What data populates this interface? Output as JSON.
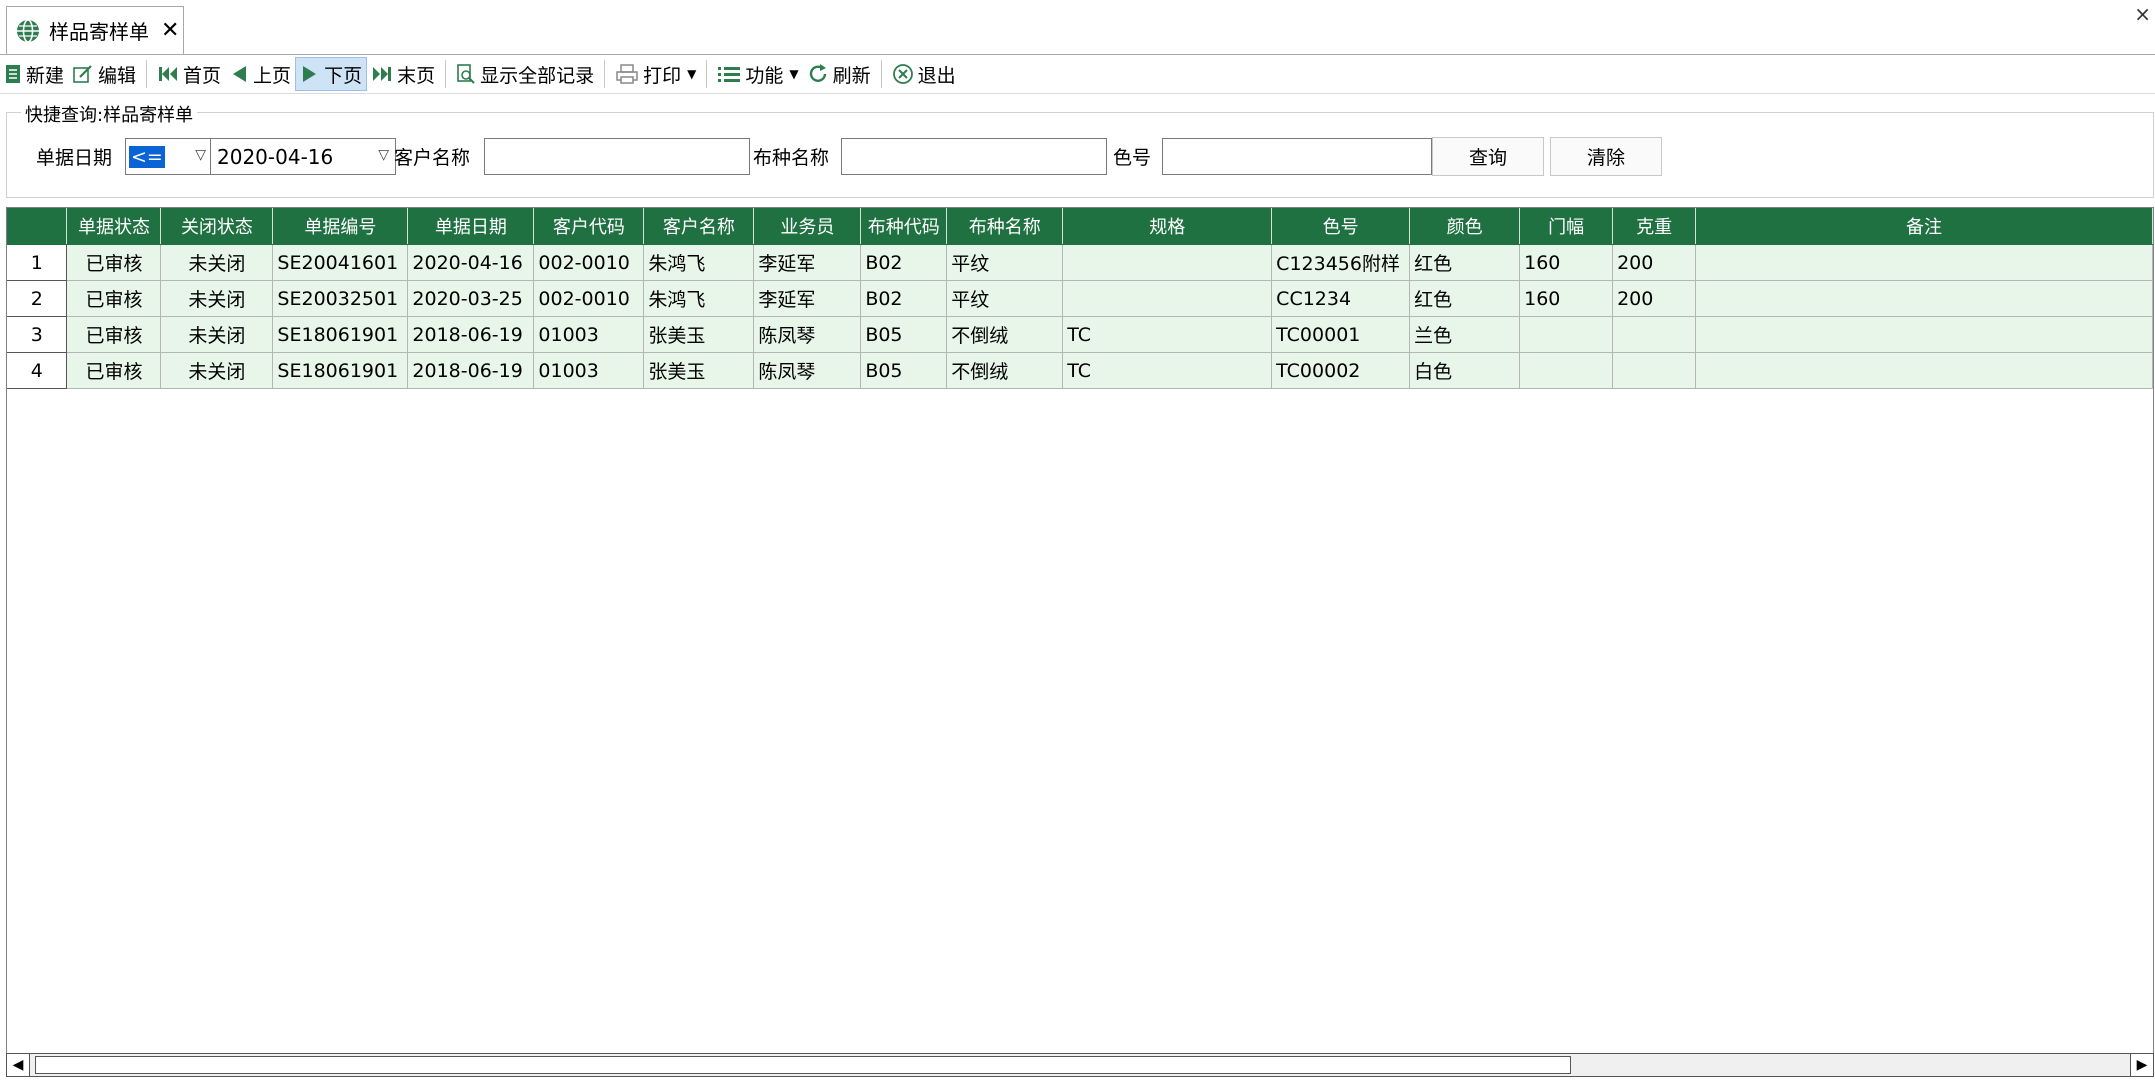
{
  "tab": {
    "label": "样品寄样单",
    "close": "✕"
  },
  "window_close": "×",
  "toolbar": {
    "new": "新建",
    "edit": "编辑",
    "first": "首页",
    "prev": "上页",
    "next": "下页",
    "last": "末页",
    "show_all": "显示全部记录",
    "print": "打印",
    "func": "功能",
    "refresh": "刷新",
    "exit": "退出"
  },
  "query": {
    "title": "快捷查询:样品寄样单",
    "date_label": "单据日期",
    "operator": "<=",
    "date_value": "2020-04-16",
    "customer_label": "客户名称",
    "customer_value": "",
    "fabric_label": "布种名称",
    "fabric_value": "",
    "color_label": "色号",
    "color_value": "",
    "search_btn": "查询",
    "clear_btn": "清除"
  },
  "grid": {
    "columns": [
      "单据状态",
      "关闭状态",
      "单据编号",
      "单据日期",
      "客户代码",
      "客户名称",
      "业务员",
      "布种代码",
      "布种名称",
      "规格",
      "色号",
      "颜色",
      "门幅",
      "克重",
      "备注"
    ],
    "rows": [
      {
        "n": "1",
        "cells": [
          "已审核",
          "未关闭",
          "SE20041601",
          "2020-04-16",
          "002-0010",
          "朱鸿飞",
          "李延军",
          "B02",
          "平纹",
          "",
          "C123456附样",
          "红色",
          "160",
          "200",
          ""
        ]
      },
      {
        "n": "2",
        "cells": [
          "已审核",
          "未关闭",
          "SE20032501",
          "2020-03-25",
          "002-0010",
          "朱鸿飞",
          "李延军",
          "B02",
          "平纹",
          "",
          "CC1234",
          "红色",
          "160",
          "200",
          ""
        ]
      },
      {
        "n": "3",
        "cells": [
          "已审核",
          "未关闭",
          "SE18061901",
          "2018-06-19",
          "01003",
          "张美玉",
          "陈凤琴",
          "B05",
          "不倒绒",
          "TC",
          "TC00001",
          "兰色",
          "",
          "",
          ""
        ]
      },
      {
        "n": "4",
        "cells": [
          "已审核",
          "未关闭",
          "SE18061901",
          "2018-06-19",
          "01003",
          "张美玉",
          "陈凤琴",
          "B05",
          "不倒绒",
          "TC",
          "TC00002",
          "白色",
          "",
          "",
          ""
        ]
      }
    ]
  },
  "colors": {
    "header_green": "#1f7142",
    "row_green": "#e8f6e9",
    "accent_blue": "#0a64d6"
  }
}
